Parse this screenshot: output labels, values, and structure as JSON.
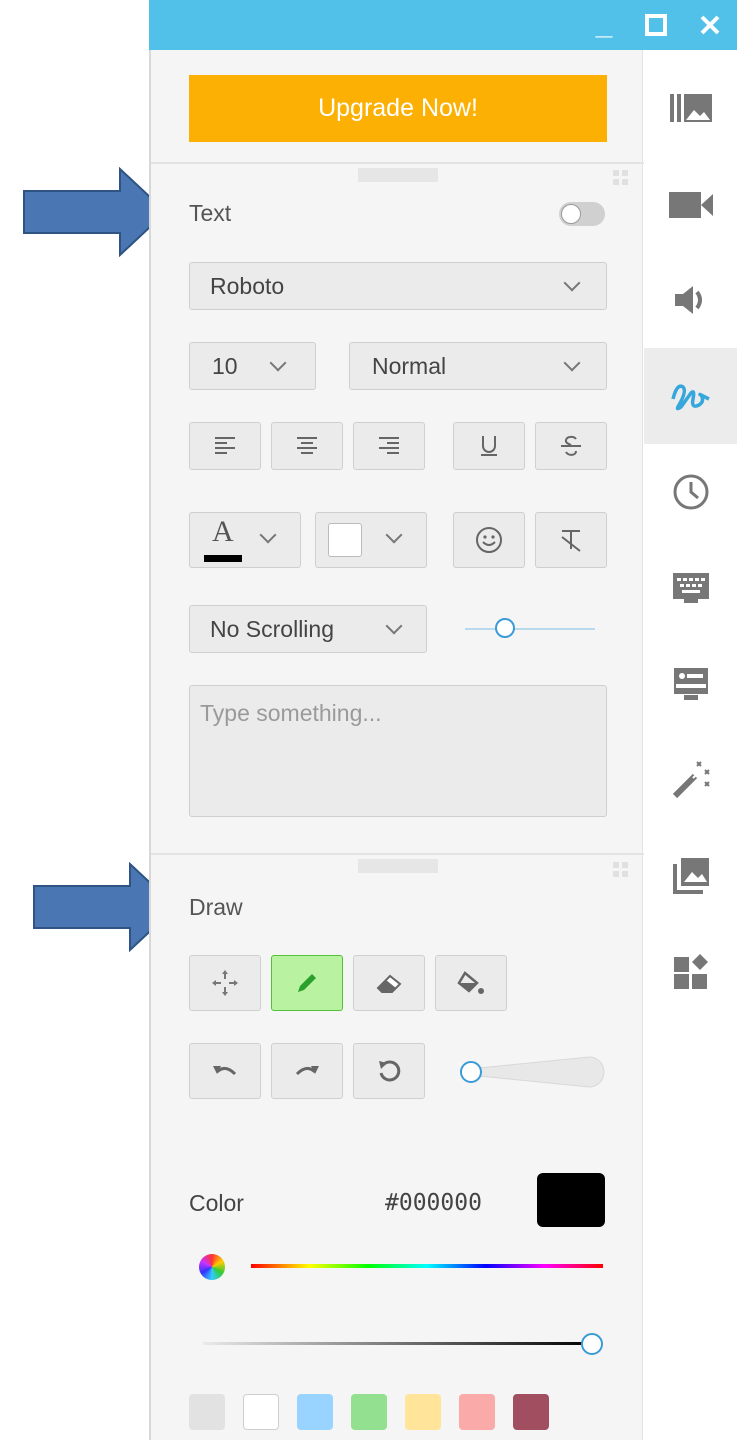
{
  "window": {
    "minimize_glyph": "_",
    "maximize_glyph": "☐",
    "close_glyph": "✕"
  },
  "upgrade": {
    "label": "Upgrade Now!"
  },
  "text_section": {
    "title": "Text",
    "toggle_on": false,
    "font": "Roboto",
    "size": "10",
    "weight": "Normal",
    "scroll": "No Scrolling",
    "textarea_placeholder": "Type something...",
    "font_color_glyph": "A"
  },
  "draw_section": {
    "title": "Draw",
    "active_tool": "pen",
    "color_label": "Color",
    "color_hex": "#000000",
    "swatches": [
      "#e2e2e2",
      "#ffffff",
      "#99d3ff",
      "#93e091",
      "#ffe49a",
      "#fbaaaa",
      "#a14f60"
    ]
  },
  "sidebar": {
    "active": "draw",
    "items": [
      "media-library",
      "camera",
      "audio",
      "draw",
      "clock",
      "keyboard",
      "presentation",
      "effects",
      "gallery",
      "widgets"
    ]
  },
  "colors": {
    "titlebar": "#52c1e9",
    "upgrade": "#fbb003",
    "accent": "#3a9bd6",
    "arrow": "#4a76b4"
  }
}
